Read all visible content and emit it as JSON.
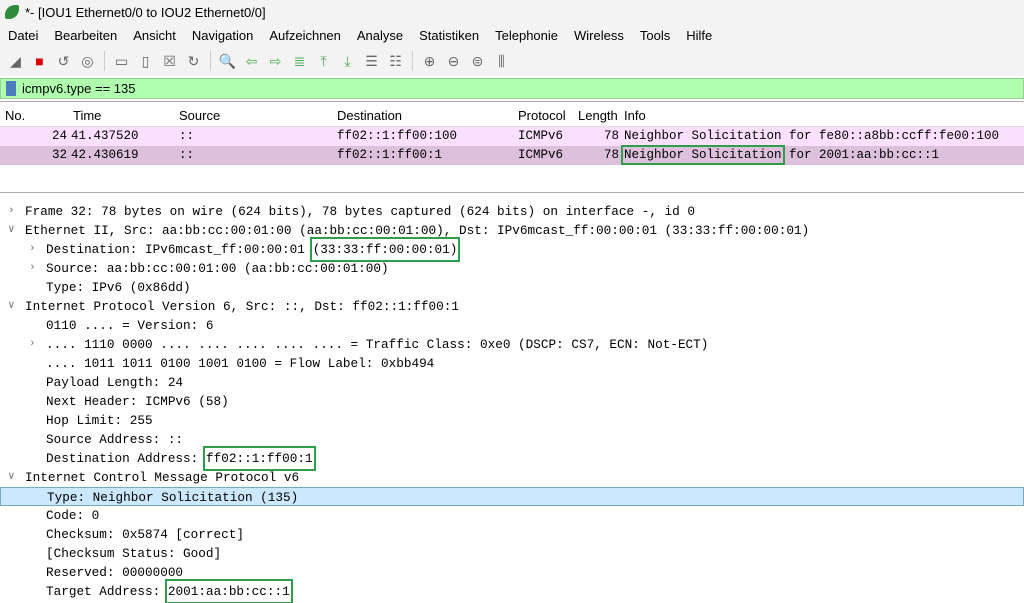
{
  "window": {
    "title": "*- [IOU1 Ethernet0/0 to IOU2 Ethernet0/0]"
  },
  "menu": [
    "Datei",
    "Bearbeiten",
    "Ansicht",
    "Navigation",
    "Aufzeichnen",
    "Analyse",
    "Statistiken",
    "Telephonie",
    "Wireless",
    "Tools",
    "Hilfe"
  ],
  "toolbar": [
    "shark-fin-start-icon",
    "stop-icon",
    "restart-icon",
    "options-icon",
    "|",
    "open-icon",
    "file-icon",
    "close-file-icon",
    "reload-icon",
    "|",
    "find-icon",
    "back-icon",
    "forward-icon",
    "go-to-packet-icon",
    "first-packet-icon",
    "last-packet-icon",
    "autoscroll-icon",
    "colorize-icon",
    "|",
    "zoom-in-icon",
    "zoom-out-icon",
    "zoom-reset-icon",
    "resize-columns-icon"
  ],
  "filter": {
    "value": "icmpv6.type == 135"
  },
  "packet_list": {
    "columns": [
      "No.",
      "Time",
      "Source",
      "Destination",
      "Protocol",
      "Length",
      "Info"
    ],
    "rows": [
      {
        "no": "24",
        "time": "41.437520",
        "source": "::",
        "destination": "ff02::1:ff00:100",
        "protocol": "ICMPv6",
        "length": "78",
        "info_a": "Neighbor Solicitation for fe80::a8bb:ccff:fe00:100",
        "info_b": ""
      },
      {
        "no": "32",
        "time": "42.430619",
        "source": "::",
        "destination": "ff02::1:ff00:1",
        "protocol": "ICMPv6",
        "length": "78",
        "info_a": "Neighbor Solicitation",
        "info_b": " for 2001:aa:bb:cc::1"
      }
    ]
  },
  "details": [
    {
      "arrow": ">",
      "indent": 0,
      "text": "Frame 32: 78 bytes on wire (624 bits), 78 bytes captured (624 bits) on interface -, id 0",
      "box": ""
    },
    {
      "arrow": "v",
      "indent": 0,
      "text": "Ethernet II, Src: aa:bb:cc:00:01:00 (aa:bb:cc:00:01:00), Dst: IPv6mcast_ff:00:00:01 (33:33:ff:00:00:01)",
      "box": ""
    },
    {
      "arrow": ">",
      "indent": 1,
      "text": "Destination: IPv6mcast_ff:00:00:01 ",
      "box": "(33:33:ff:00:00:01)"
    },
    {
      "arrow": ">",
      "indent": 1,
      "text": "Source: aa:bb:cc:00:01:00 (aa:bb:cc:00:01:00)",
      "box": ""
    },
    {
      "arrow": "",
      "indent": 1,
      "text": "Type: IPv6 (0x86dd)",
      "box": ""
    },
    {
      "arrow": "v",
      "indent": 0,
      "text": "Internet Protocol Version 6, Src: ::, Dst: ff02::1:ff00:1",
      "box": ""
    },
    {
      "arrow": "",
      "indent": 1,
      "text": "0110 .... = Version: 6",
      "box": ""
    },
    {
      "arrow": ">",
      "indent": 1,
      "text": ".... 1110 0000 .... .... .... .... .... = Traffic Class: 0xe0 (DSCP: CS7, ECN: Not-ECT)",
      "box": ""
    },
    {
      "arrow": "",
      "indent": 1,
      "text": ".... 1011 1011 0100 1001 0100 = Flow Label: 0xbb494",
      "box": ""
    },
    {
      "arrow": "",
      "indent": 1,
      "text": "Payload Length: 24",
      "box": ""
    },
    {
      "arrow": "",
      "indent": 1,
      "text": "Next Header: ICMPv6 (58)",
      "box": ""
    },
    {
      "arrow": "",
      "indent": 1,
      "text": "Hop Limit: 255",
      "box": ""
    },
    {
      "arrow": "",
      "indent": 1,
      "text": "Source Address: ::",
      "box": ""
    },
    {
      "arrow": "",
      "indent": 1,
      "text": "Destination Address: ",
      "box": "ff02::1:ff00:1"
    },
    {
      "arrow": "v",
      "indent": 0,
      "text": "Internet Control Message Protocol v6",
      "box": ""
    },
    {
      "arrow": "",
      "indent": 1,
      "text": "Type: Neighbor Solicitation (135)",
      "box": "",
      "selected": true
    },
    {
      "arrow": "",
      "indent": 1,
      "text": "Code: 0",
      "box": ""
    },
    {
      "arrow": "",
      "indent": 1,
      "text": "Checksum: 0x5874 [correct]",
      "box": ""
    },
    {
      "arrow": "",
      "indent": 1,
      "text": "[Checksum Status: Good]",
      "box": ""
    },
    {
      "arrow": "",
      "indent": 1,
      "text": "Reserved: 00000000",
      "box": ""
    },
    {
      "arrow": "",
      "indent": 1,
      "text": "Target Address: ",
      "box": "2001:aa:bb:cc::1"
    }
  ],
  "colors": {
    "filter_bg": "#afffaf",
    "row_icmpv6": "#fce0ff",
    "row_selected": "#dcc0dc",
    "highlight_box": "#2e9e4a"
  }
}
